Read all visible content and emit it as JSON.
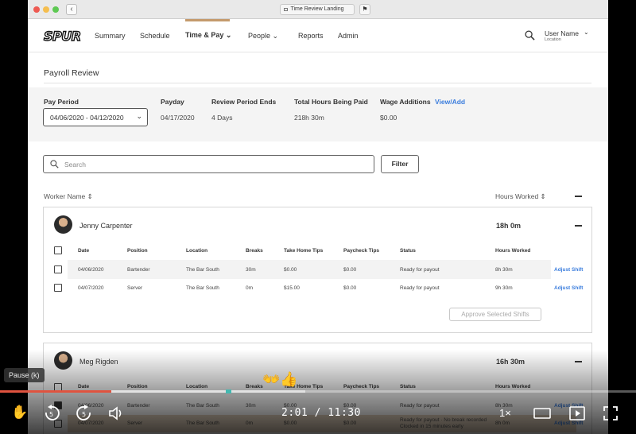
{
  "browser": {
    "tab_title": "Time Review Landing",
    "back_glyph": "‹",
    "flag_glyph": "⚑"
  },
  "nav": {
    "logo": "SPUR",
    "items": [
      "Summary",
      "Schedule",
      "Time & Pay",
      "People",
      "Reports",
      "Admin"
    ],
    "active_item": "Time & Pay",
    "user_name": "User Name",
    "user_location": "Location",
    "chevron": "⌄"
  },
  "page": {
    "title": "Payroll Review"
  },
  "summary": {
    "pay_period_label": "Pay Period",
    "pay_period_value": "04/06/2020 - 04/12/2020",
    "payday_label": "Payday",
    "payday_value": "04/17/2020",
    "review_end_label": "Review Period Ends",
    "review_end_value": "4 Days",
    "total_hours_label": "Total Hours Being Paid",
    "total_hours_value": "218h 30m",
    "wage_additions_label": "Wage Additions",
    "wage_additions_link": "View/Add",
    "wage_additions_value": "$0.00"
  },
  "search": {
    "placeholder": "Search",
    "filter_label": "Filter"
  },
  "list_header": {
    "worker_name": "Worker Name ⇕",
    "hours_worked": "Hours Worked ⇕"
  },
  "table_headers": [
    "Date",
    "Position",
    "Location",
    "Breaks",
    "Take Home Tips",
    "Paycheck Tips",
    "Status",
    "Hours Worked"
  ],
  "workers": [
    {
      "name": "Jenny Carpenter",
      "hours": "18h 0m",
      "shifts": [
        {
          "date": "04/06/2020",
          "position": "Bartender",
          "location": "The Bar South",
          "breaks": "30m",
          "take_home_tips": "$0.00",
          "paycheck_tips": "$0.00",
          "status": "Ready for payout",
          "hours": "8h 30m",
          "action": "Adjust Shift"
        },
        {
          "date": "04/07/2020",
          "position": "Server",
          "location": "The Bar South",
          "breaks": "0m",
          "take_home_tips": "$15.00",
          "paycheck_tips": "$0.00",
          "status": "Ready for payout",
          "hours": "9h 30m",
          "action": "Adjust Shift"
        }
      ],
      "approve_label": "Approve Selected Shifts"
    },
    {
      "name": "Meg Rigden",
      "hours": "16h 30m",
      "shifts": [
        {
          "date": "04/06/2020",
          "position": "Bartender",
          "location": "The Bar South",
          "breaks": "30m",
          "take_home_tips": "$0.00",
          "paycheck_tips": "$0.00",
          "status": "Ready for payout",
          "hours": "8h 30m",
          "action": "Adjust Shift"
        },
        {
          "date": "04/07/2020",
          "position": "Server",
          "location": "The Bar South",
          "breaks": "0m",
          "take_home_tips": "$0.00",
          "paycheck_tips": "$0.00",
          "status": "Ready for payout · No break recorded",
          "status_note": "Clocked in 15 minutes early",
          "hours": "8h 0m",
          "action": "Adjust Shift"
        }
      ]
    }
  ],
  "video": {
    "pause_tooltip": "Pause (k)",
    "time": "2:01 / 11:30",
    "speed": "1×",
    "progress_played": 0.175,
    "progress_buffered": 0.48,
    "icons": [
      "hand-icon",
      "rewind-5-icon",
      "forward-5-icon",
      "volume-icon",
      "captions-icon",
      "miniplayer-icon",
      "fullscreen-icon"
    ]
  }
}
